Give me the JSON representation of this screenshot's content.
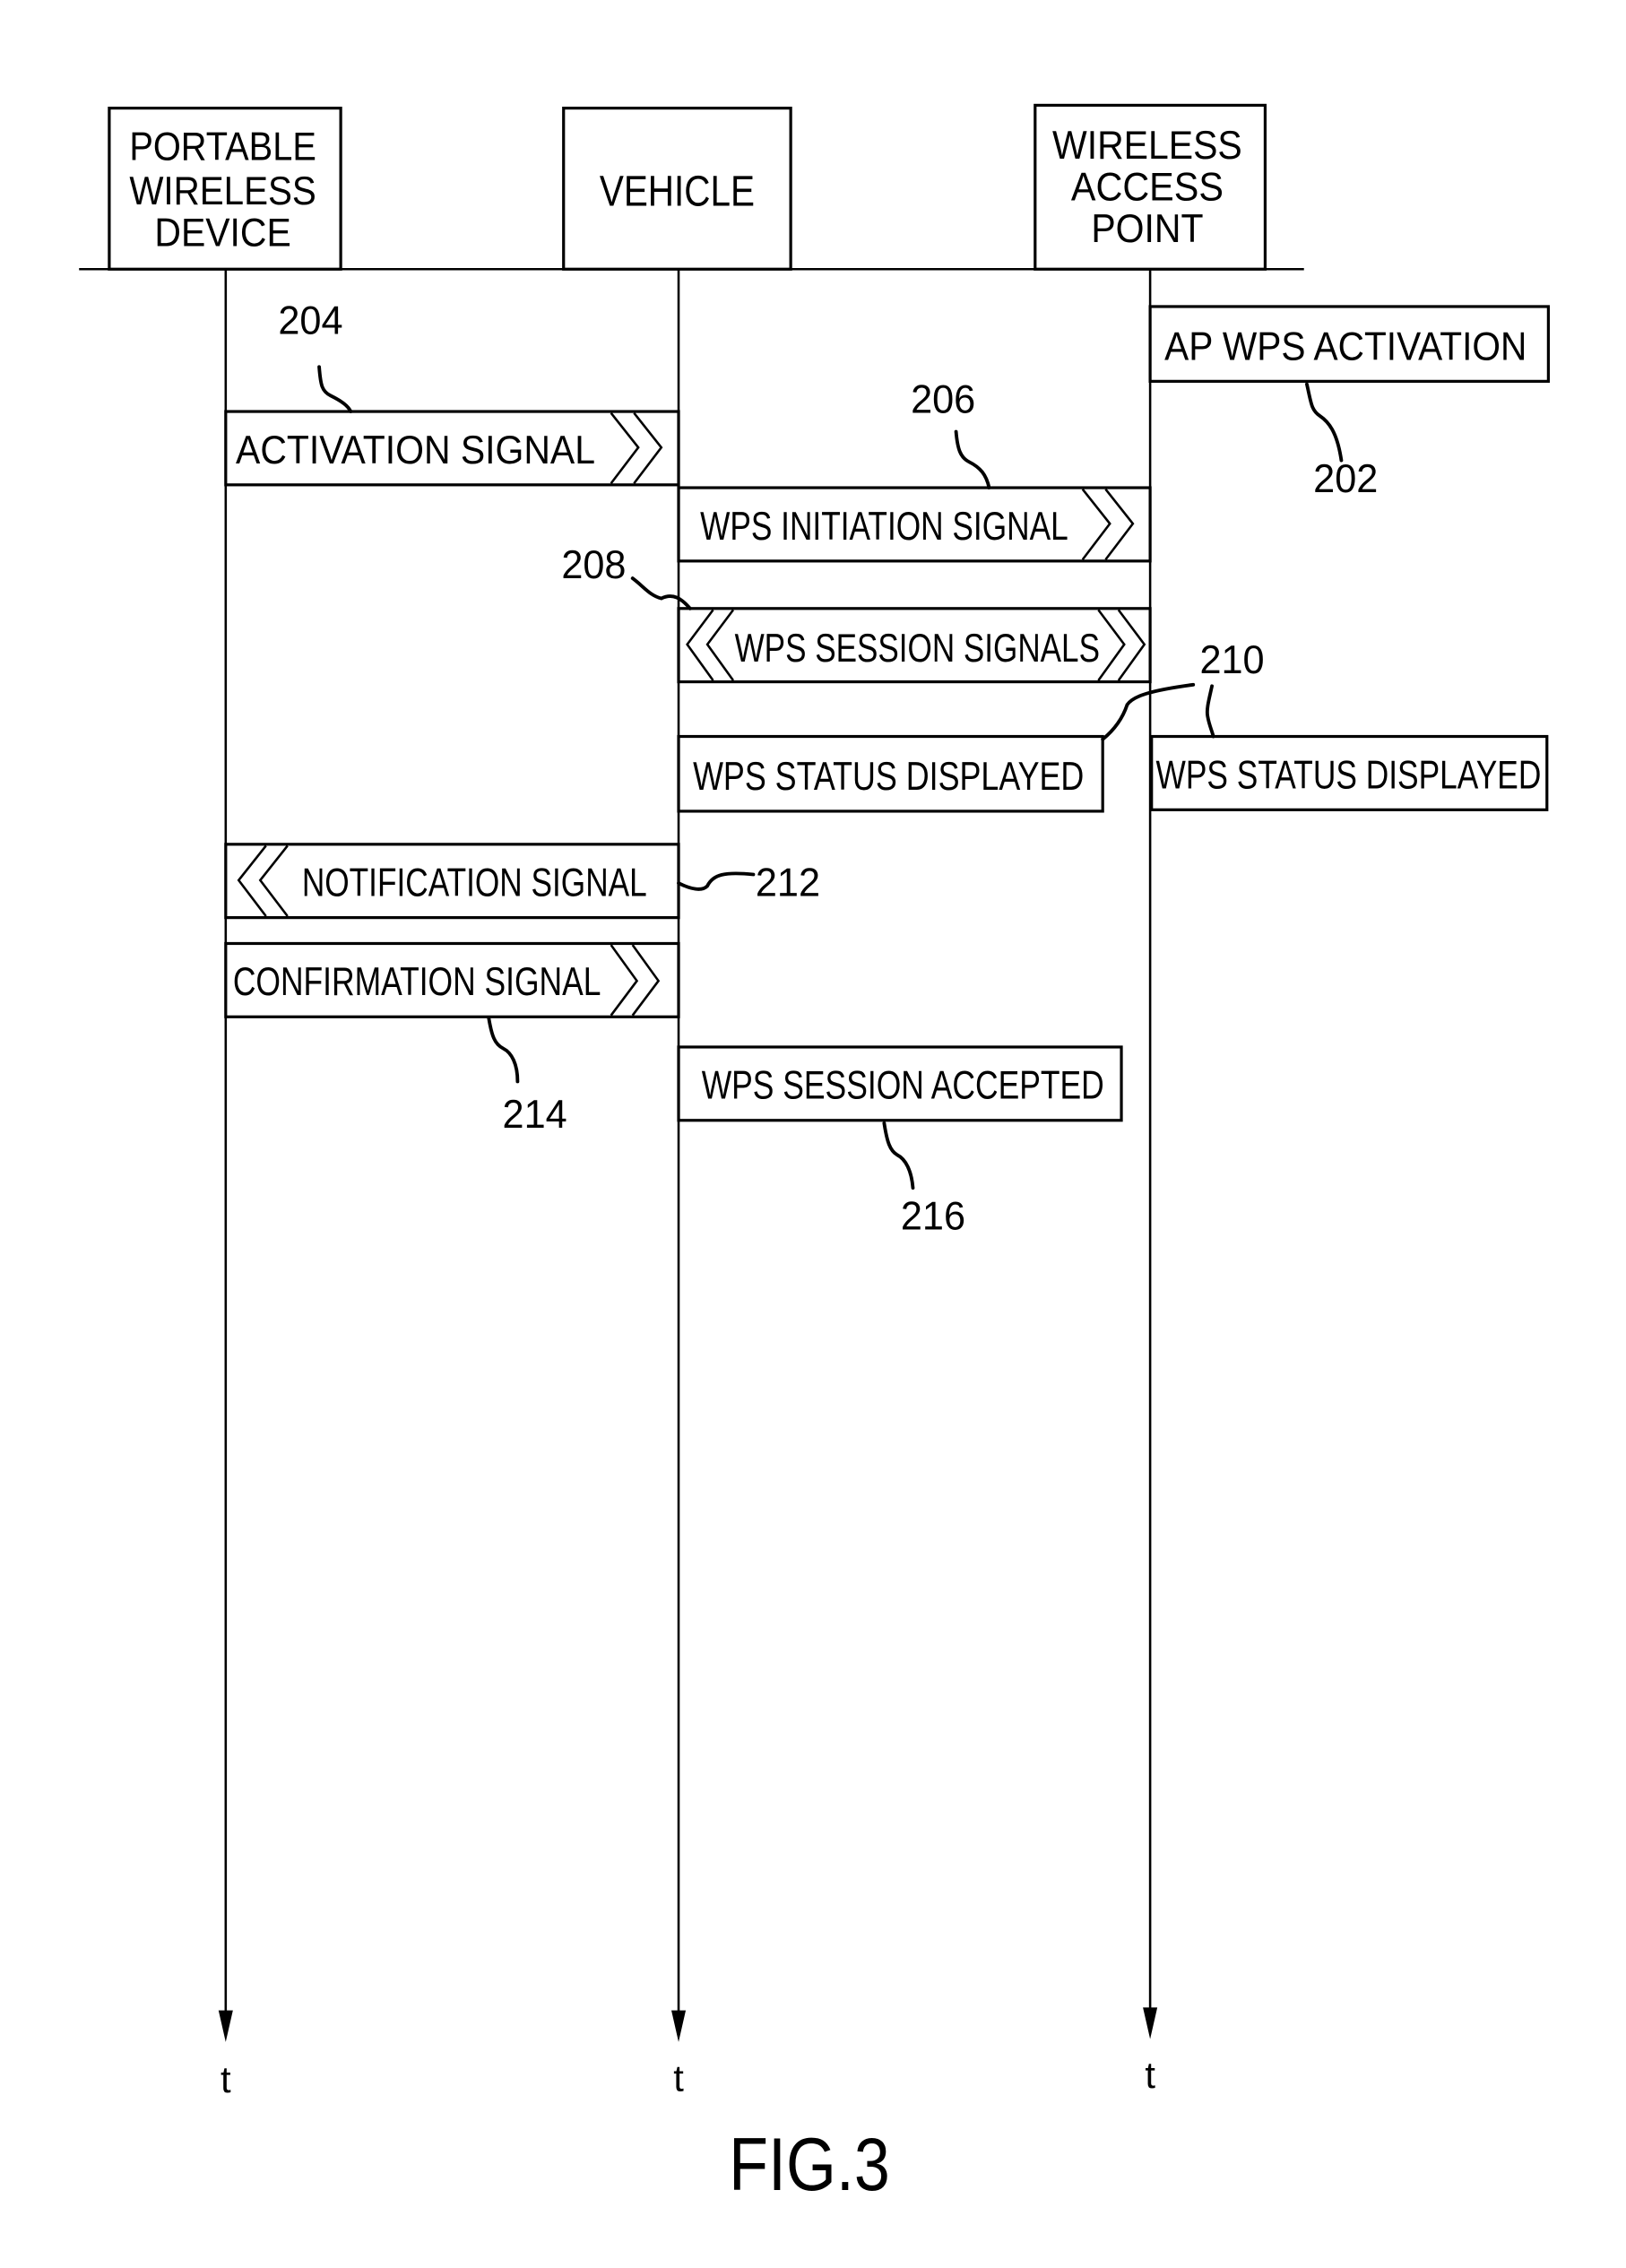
{
  "figure": {
    "caption": "FIG.3",
    "time_axis_label": "t"
  },
  "participants": [
    {
      "id": "portable",
      "lines": [
        "PORTABLE",
        "WIRELESS",
        "DEVICE"
      ]
    },
    {
      "id": "vehicle",
      "lines": [
        "VEHICLE"
      ]
    },
    {
      "id": "access_point",
      "lines": [
        "WIRELESS",
        "ACCESS",
        "POINT"
      ]
    }
  ],
  "steps": [
    {
      "ref": "202",
      "label": "AP WPS ACTIVATION",
      "type": "action",
      "at": "access_point"
    },
    {
      "ref": "204",
      "label": "ACTIVATION SIGNAL",
      "type": "message",
      "from": "portable",
      "to": "vehicle",
      "direction": "right"
    },
    {
      "ref": "206",
      "label": "WPS INITIATION SIGNAL",
      "type": "message",
      "from": "vehicle",
      "to": "access_point",
      "direction": "right"
    },
    {
      "ref": "208",
      "label": "WPS SESSION SIGNALS",
      "type": "message",
      "from": "vehicle",
      "to": "access_point",
      "direction": "both"
    },
    {
      "ref": "210",
      "label": "WPS STATUS DISPLAYED",
      "type": "action",
      "at": "vehicle"
    },
    {
      "ref": "210",
      "label": "WPS STATUS DISPLAYED",
      "type": "action",
      "at": "access_point"
    },
    {
      "ref": "212",
      "label": "NOTIFICATION SIGNAL",
      "type": "message",
      "from": "vehicle",
      "to": "portable",
      "direction": "left"
    },
    {
      "ref": "214",
      "label": "CONFIRMATION SIGNAL",
      "type": "message",
      "from": "portable",
      "to": "vehicle",
      "direction": "right"
    },
    {
      "ref": "216",
      "label": "WPS SESSION ACCEPTED",
      "type": "action",
      "at": "vehicle"
    }
  ]
}
